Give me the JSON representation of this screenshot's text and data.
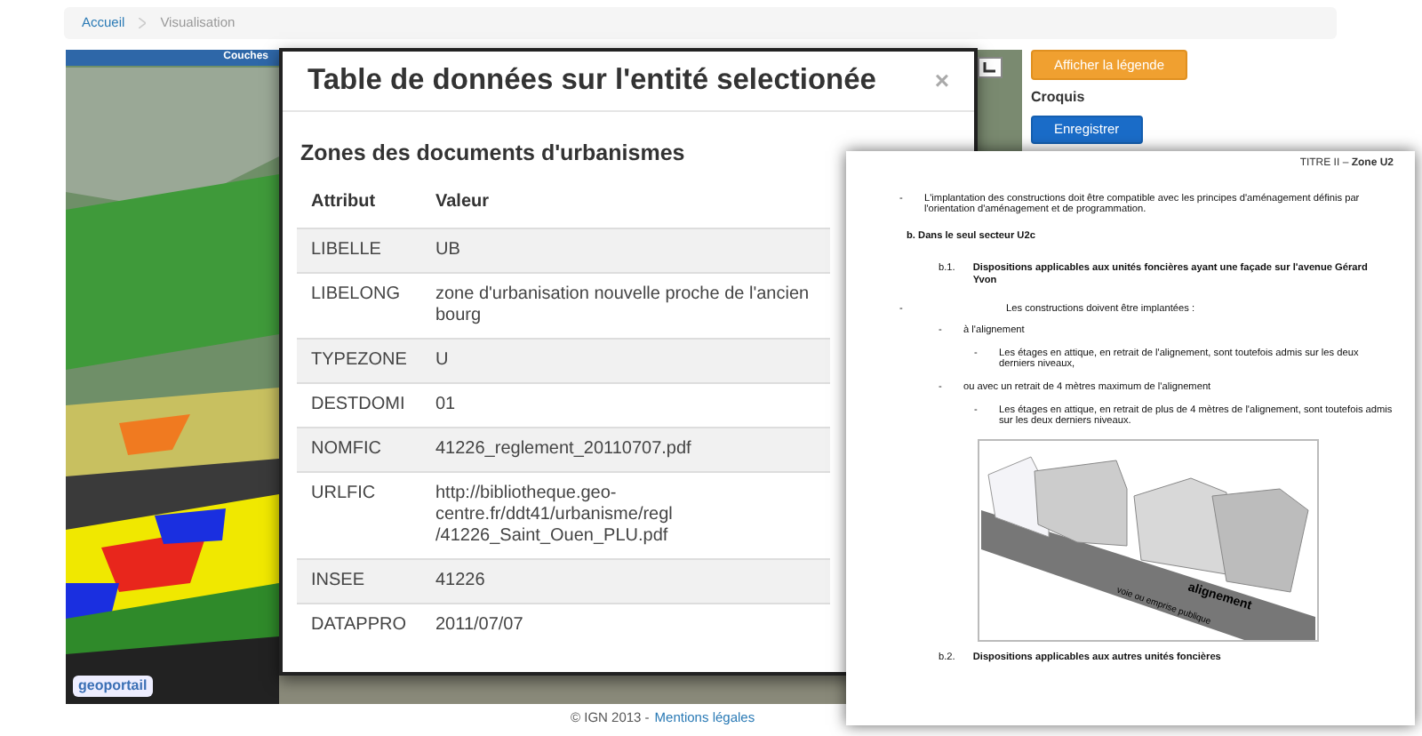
{
  "breadcrumb": [
    {
      "label": "Accueil",
      "selected": false
    },
    {
      "label": "Visualisation",
      "selected": true
    }
  ],
  "map": {
    "panel_title": "Couches",
    "logo_text": "geoportail"
  },
  "sidebar": {
    "legend_button": "Afficher la légende",
    "section_title": "Croquis",
    "save_button": "Enregistrer"
  },
  "modal": {
    "title": "Table de données sur l'entité selectionée",
    "close": "×",
    "section_title": "Zones des documents d'urbanismes",
    "columns": [
      "Attribut",
      "Valeur"
    ],
    "rows": [
      {
        "attribut": "LIBELLE",
        "valeur": [
          "UB"
        ]
      },
      {
        "attribut": "LIBELONG",
        "valeur": [
          "zone d'urbanisation nouvelle proche de l'ancien bourg"
        ]
      },
      {
        "attribut": "TYPEZONE",
        "valeur": [
          "U"
        ]
      },
      {
        "attribut": "DESTDOMI",
        "valeur": [
          "01"
        ]
      },
      {
        "attribut": "NOMFIC",
        "valeur": [
          "41226_reglement_20110707.pdf"
        ]
      },
      {
        "attribut": "URLFIC",
        "valeur": [
          "http://bibliotheque.geo-centre.fr/ddt41/urbanisme/regl",
          "/41226_Saint_Ouen_PLU.pdf"
        ]
      },
      {
        "attribut": "INSEE",
        "valeur": [
          "41226"
        ]
      },
      {
        "attribut": "DATAPPRO",
        "valeur": [
          "2011/07/07"
        ]
      }
    ]
  },
  "document": {
    "header": "TITRE II – **Zone U2**",
    "items": [
      {
        "kind": "bullet",
        "marker": "-",
        "text": "L'implantation des constructions doit être compatible avec les principes d'aménagement définis par l'orientation d'aménagement et de programmation."
      },
      {
        "kind": "heading",
        "number": "b.",
        "text": "Dans le seul secteur U2c"
      },
      {
        "kind": "subheading",
        "number": "b.1.",
        "text": "Dispositions applicables aux unités foncières ayant une façade sur l'avenue Gérard Yvon"
      },
      {
        "kind": "bullet",
        "marker": "-",
        "text": "Les constructions doivent être implantées :",
        "children": [
          {
            "kind": "bullet",
            "marker": "-",
            "text": "à l'alignement",
            "children": [
              {
                "kind": "bullet",
                "marker": "-",
                "text": "Les étages en attique, en retrait de l'alignement, sont toutefois admis sur les deux derniers niveaux,"
              }
            ]
          },
          {
            "kind": "bullet",
            "marker": "-",
            "text": "ou avec un retrait de 4 mètres maximum de l'alignement",
            "children": [
              {
                "kind": "bullet",
                "marker": "-",
                "text": "Les étages en attique, en retrait de plus de 4 mètres de l'alignement, sont toutefois admis sur les deux derniers niveaux."
              }
            ]
          }
        ]
      },
      {
        "kind": "figure",
        "labels": [
          "alignement",
          "voie ou emprise publique"
        ]
      },
      {
        "kind": "subheading",
        "number": "b.2.",
        "text": "Dispositions applicables aux autres unités foncières"
      }
    ]
  },
  "footer": {
    "copyright": "© IGN 2013 -",
    "link": "Mentions légales"
  }
}
